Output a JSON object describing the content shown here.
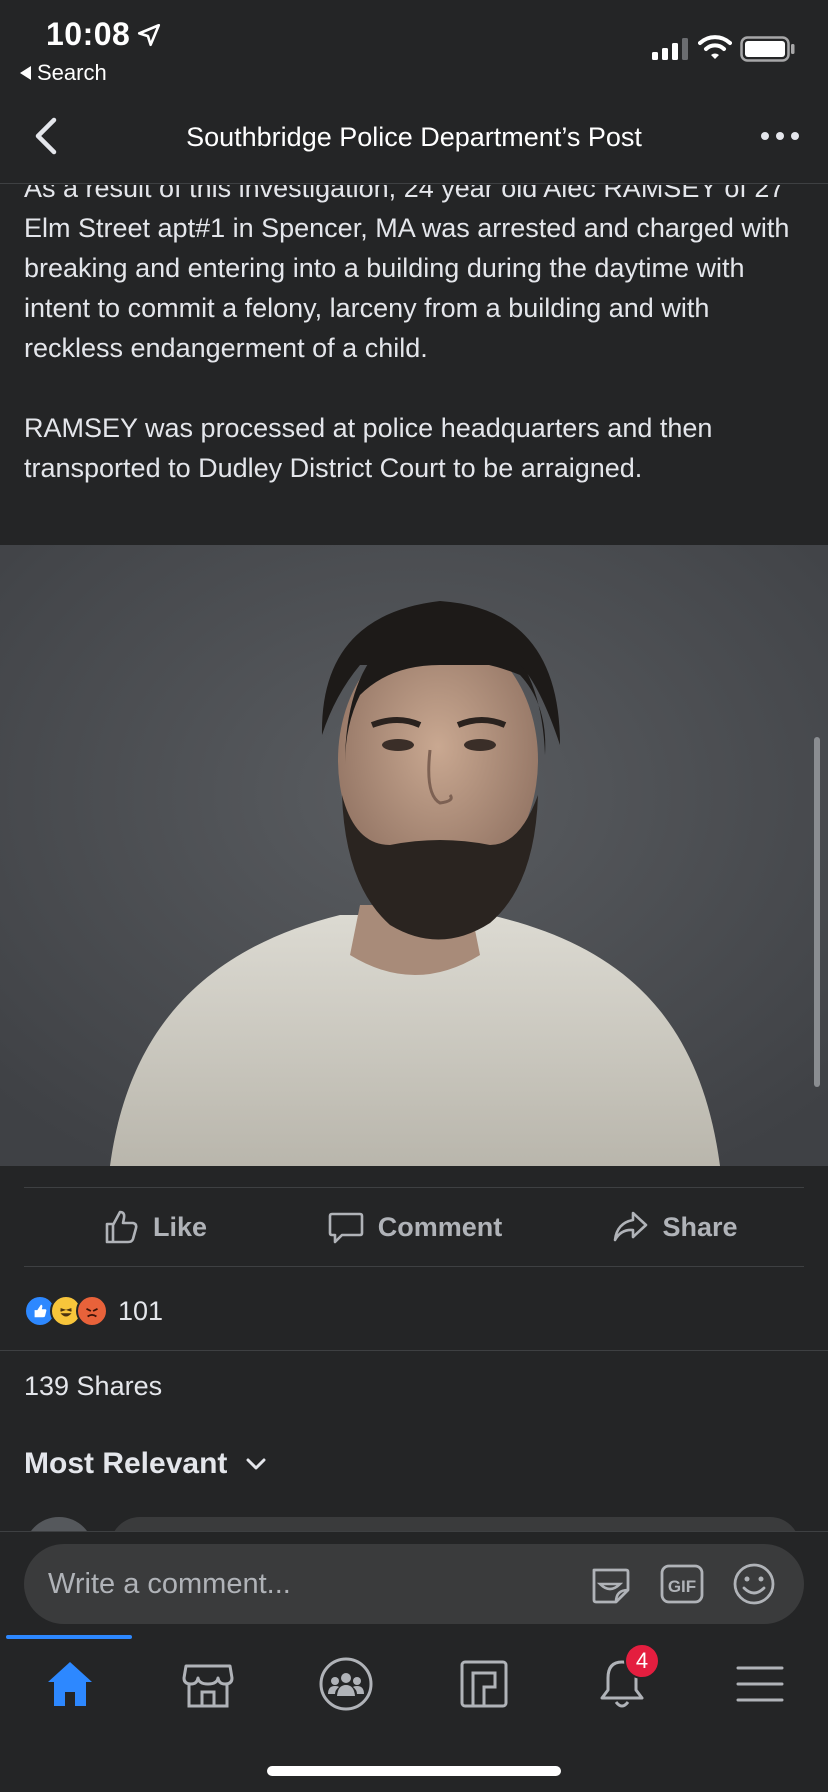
{
  "status_bar": {
    "time": "10:08",
    "back_app": "Search"
  },
  "nav": {
    "title": "Southbridge Police Department’s Post"
  },
  "post": {
    "text": "As a result of this investigation, 24 year old Alec RAMSEY of 27 Elm Street apt#1 in Spencer, MA was arrested and charged with breaking and entering into a building during the daytime with intent to commit a felony, larceny from a building and with reckless endangerment of a child.\n\nRAMSEY was processed at police headquarters and then transported to Dudley District Court to be arraigned."
  },
  "actions": {
    "like": "Like",
    "comment": "Comment",
    "share": "Share"
  },
  "reactions": {
    "count": "101",
    "types": [
      "like-icon",
      "haha-icon",
      "angry-icon"
    ]
  },
  "shares": "139 Shares",
  "comments_filter": "Most Relevant",
  "composer": {
    "placeholder": "Write a comment..."
  },
  "tabbar": {
    "tabs": [
      "home-icon",
      "marketplace-icon",
      "groups-icon",
      "pages-icon",
      "notifications-icon",
      "menu-icon"
    ],
    "notifications_badge": "4"
  },
  "colors": {
    "accent": "#2d88ff",
    "background": "#242526",
    "badge": "#e41e3f",
    "text": "#e4e6eb",
    "secondary_text": "#b0b3b8"
  }
}
